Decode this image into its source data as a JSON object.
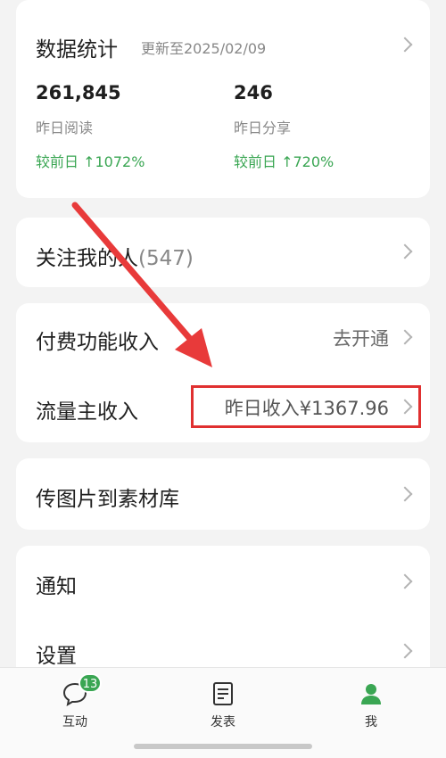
{
  "stats": {
    "title": "数据统计",
    "updated": "更新至2025/02/09",
    "reads": {
      "value": "261,845",
      "label": "昨日阅读",
      "change": "较前日 ↑1072%"
    },
    "shares": {
      "value": "246",
      "label": "昨日分享",
      "change": "较前日 ↑720%"
    }
  },
  "follow": {
    "label": "关注我的人",
    "count": "(547)"
  },
  "income": {
    "paid_label": "付费功能收入",
    "paid_action": "去开通",
    "traffic_label": "流量主收入",
    "traffic_value": "昨日收入¥1367.96"
  },
  "upload": {
    "label": "传图片到素材库"
  },
  "menu": {
    "notify": "通知",
    "settings": "设置"
  },
  "nav": {
    "interact": "互动",
    "interact_badge": "13",
    "publish": "发表",
    "me": "我"
  },
  "colors": {
    "accent": "#3aa653",
    "highlight": "#e03030"
  }
}
